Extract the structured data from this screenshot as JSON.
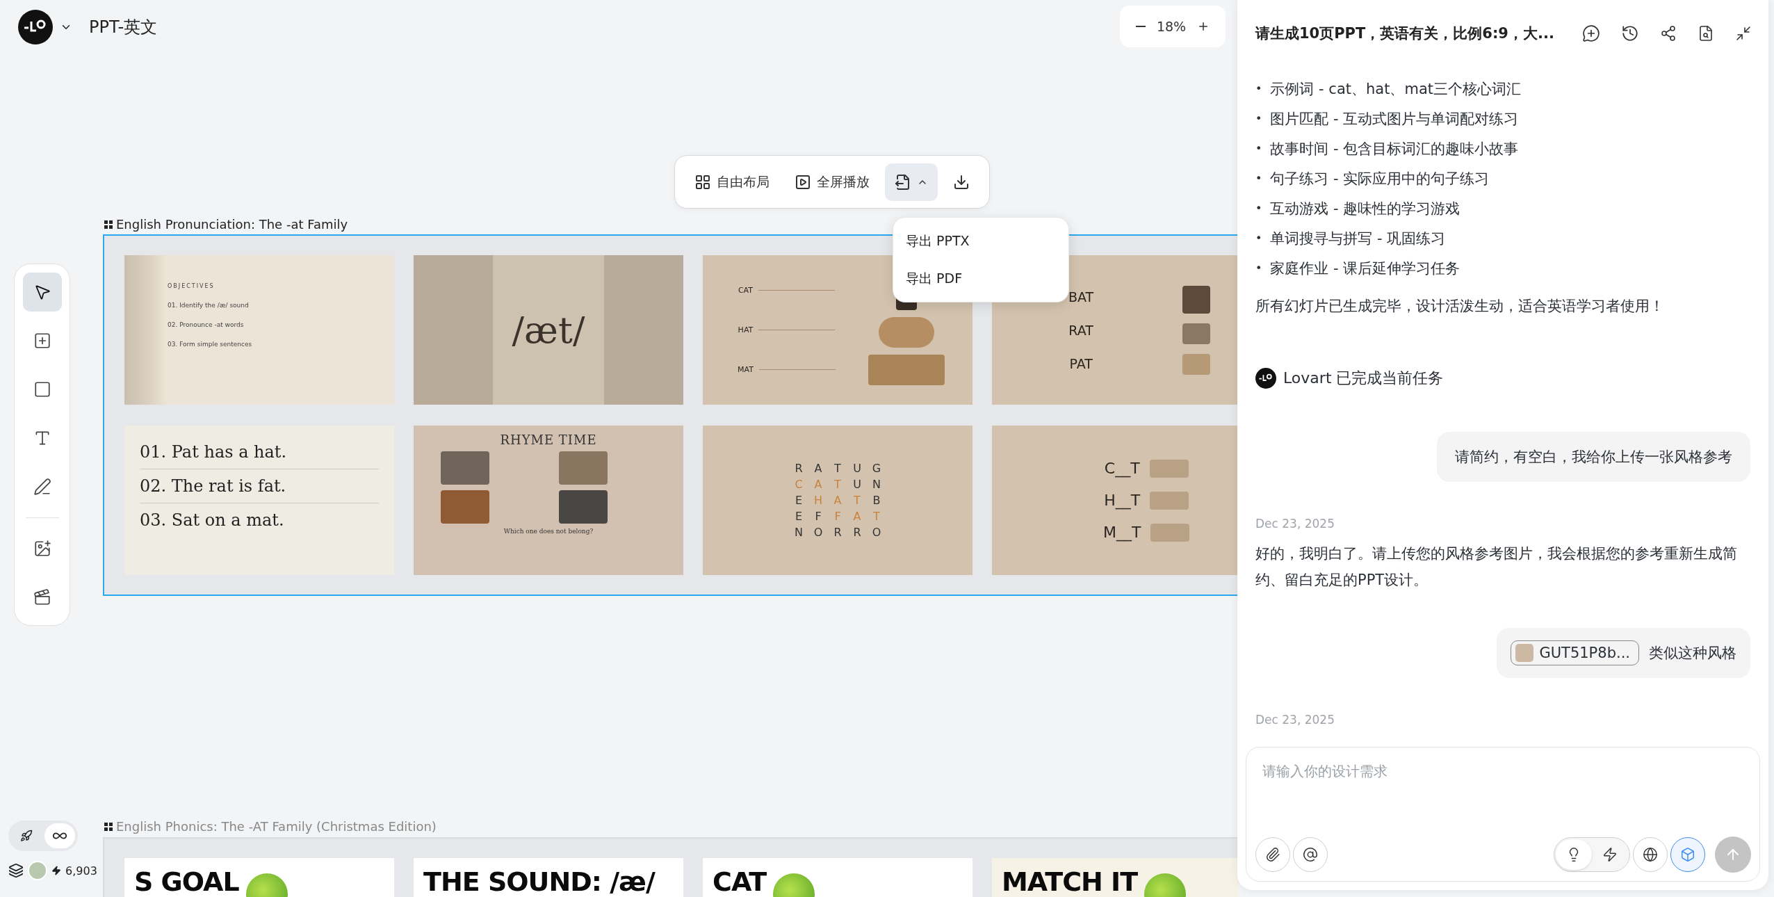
{
  "project": {
    "title": "PPT-英文"
  },
  "zoom": {
    "value": "18%"
  },
  "toolbar": {
    "items": [
      {
        "kind": "layout",
        "label": "自由布局",
        "selected": false
      },
      {
        "kind": "play",
        "label": "全屏播放",
        "selected": false
      },
      {
        "kind": "export",
        "selected": true
      },
      {
        "kind": "download",
        "selected": false
      }
    ]
  },
  "export_menu": {
    "items": [
      "导出 PPTX",
      "导出 PDF"
    ]
  },
  "tools": [
    {
      "kind": "select",
      "selected": true
    },
    {
      "kind": "frame",
      "selected": false
    },
    {
      "kind": "rectangle",
      "selected": false
    },
    {
      "kind": "text",
      "selected": false
    },
    {
      "kind": "pen",
      "selected": false
    },
    {
      "kind": "divider"
    },
    {
      "kind": "image",
      "selected": false
    },
    {
      "kind": "video",
      "selected": false
    }
  ],
  "frames": [
    {
      "title": "English Pronunciation: The -at Family",
      "selected": true,
      "slides": [
        {
          "kind": "objectives",
          "heading": "OBJECTIVES",
          "lines": [
            "01. Identify the /æ/ sound",
            "02. Pronounce -at words",
            "03. Form simple sentences"
          ]
        },
        {
          "kind": "phoneme",
          "heading": "/æt/"
        },
        {
          "kind": "word_list",
          "lines": [
            "CAT",
            "HAT",
            "MAT"
          ]
        },
        {
          "kind": "match",
          "lines": [
            "BAT",
            "RAT",
            "PAT"
          ]
        },
        {
          "kind": "sentences",
          "lines": [
            "01. Pat has a hat.",
            "02. The rat is fat.",
            "03. Sat on a mat."
          ]
        },
        {
          "kind": "rhyme",
          "heading": "RHYME TIME",
          "lines": [
            "Which one does not belong?"
          ]
        },
        {
          "kind": "word_search",
          "grid": [
            [
              {
                "letter": "R",
                "highlighted": false
              },
              {
                "letter": "A",
                "highlighted": false
              },
              {
                "letter": "T",
                "highlighted": false
              },
              {
                "letter": "U",
                "highlighted": false
              },
              {
                "letter": "G",
                "highlighted": false
              }
            ],
            [
              {
                "letter": "C",
                "highlighted": true
              },
              {
                "letter": "A",
                "highlighted": true
              },
              {
                "letter": "T",
                "highlighted": true
              },
              {
                "letter": "U",
                "highlighted": false
              },
              {
                "letter": "N",
                "highlighted": false
              }
            ],
            [
              {
                "letter": "E",
                "highlighted": false
              },
              {
                "letter": "H",
                "highlighted": true
              },
              {
                "letter": "A",
                "highlighted": true
              },
              {
                "letter": "T",
                "highlighted": true
              },
              {
                "letter": "B",
                "highlighted": false
              }
            ],
            [
              {
                "letter": "E",
                "highlighted": false
              },
              {
                "letter": "F",
                "highlighted": false
              },
              {
                "letter": "F",
                "highlighted": true
              },
              {
                "letter": "A",
                "highlighted": true
              },
              {
                "letter": "T",
                "highlighted": true
              }
            ],
            [
              {
                "letter": "N",
                "highlighted": false
              },
              {
                "letter": "O",
                "highlighted": false
              },
              {
                "letter": "R",
                "highlighted": false
              },
              {
                "letter": "R",
                "highlighted": false
              },
              {
                "letter": "O",
                "highlighted": false
              }
            ]
          ]
        },
        {
          "kind": "fill_blank",
          "lines": [
            "C__T",
            "H__T",
            "M__T"
          ]
        }
      ]
    },
    {
      "title": "English Phonics: The -AT Family (Christmas Edition)",
      "selected": false,
      "slides": [
        {
          "kind": "title",
          "heading": "S GOAL"
        },
        {
          "kind": "title",
          "heading": "THE SOUND: /æ/"
        },
        {
          "kind": "title",
          "heading": "CAT"
        },
        {
          "kind": "title",
          "heading": "MATCH IT"
        }
      ]
    }
  ],
  "footer": {
    "credits": "6,903",
    "modes": [
      {
        "kind": "rocket",
        "selected": false
      },
      {
        "kind": "infinite",
        "selected": true
      }
    ]
  },
  "chat": {
    "title": "请生成10页PPT，英语有关，比例6:9，大...",
    "messages": [
      {
        "kind": "bullets",
        "marker": "•",
        "items": [
          "示例词 - cat、hat、mat三个核心词汇",
          "图片匹配 - 互动式图片与单词配对练习",
          "故事时间 - 包含目标词汇的趣味小故事",
          "句子练习 - 实际应用中的句子练习",
          "互动游戏 - 趣味性的学习游戏",
          "单词搜寻与拼写 - 巩固练习",
          "家庭作业 - 课后延伸学习任务"
        ]
      },
      {
        "kind": "text",
        "text": "所有幻灯片已生成完毕，设计活泼生动，适合英语学习者使用！"
      },
      {
        "kind": "status",
        "text": "Lovart 已完成当前任务"
      },
      {
        "kind": "user",
        "text": "请简约，有空白，我给你上传一张风格参考"
      },
      {
        "kind": "date",
        "text": "Dec 23, 2025"
      },
      {
        "kind": "text",
        "text": "好的，我明白了。请上传您的风格参考图片，我会根据您的参考重新生成简约、留白充足的PPT设计。"
      },
      {
        "kind": "attachment",
        "file": "GUT51P8b...",
        "text": "类似这种风格"
      },
      {
        "kind": "date",
        "text": "Dec 23, 2025"
      }
    ],
    "input": {
      "placeholder": "请输入你的设计需求"
    },
    "options": [
      {
        "kind": "idea",
        "selected": true
      },
      {
        "kind": "fast",
        "selected": false
      }
    ],
    "web_search": {
      "on": false
    },
    "model_3d": {
      "on": true
    },
    "send": {
      "disabled": true
    }
  }
}
